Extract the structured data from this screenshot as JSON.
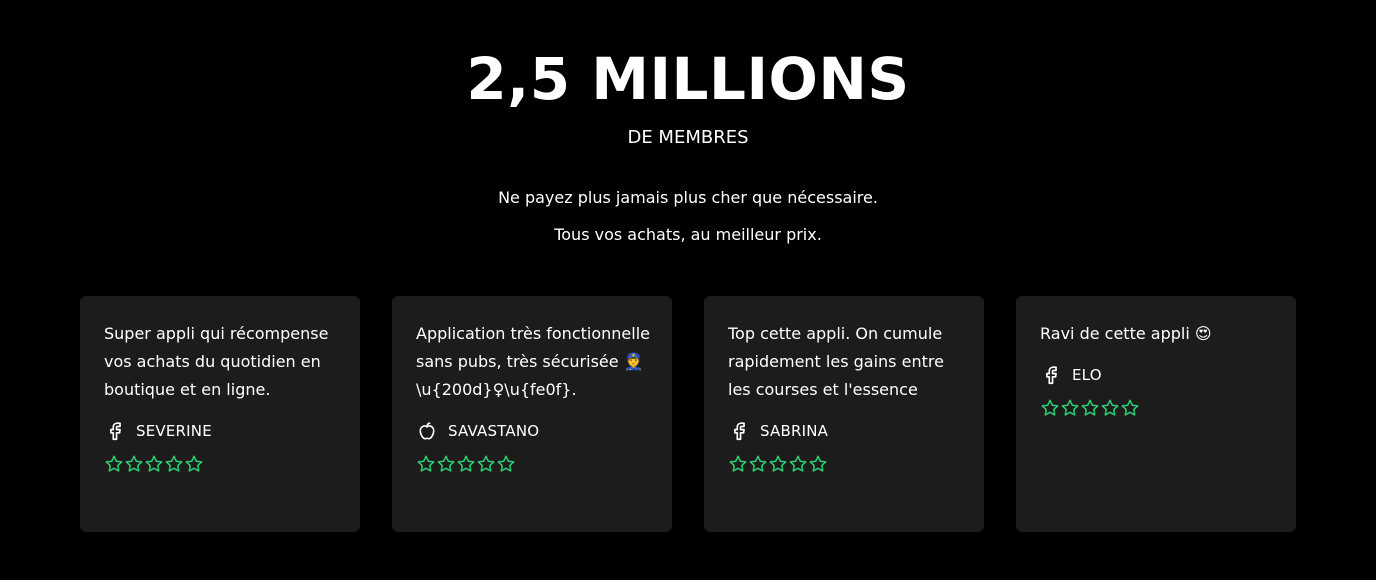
{
  "hero": {
    "headline": "2,5 MILLIONS",
    "subhead": "DE MEMBRES",
    "tagline_line1": "Ne payez plus jamais plus cher que nécessaire.",
    "tagline_line2": "Tous vos achats, au meilleur prix."
  },
  "colors": {
    "background": "#000000",
    "card": "#1c1c1c",
    "text": "#ffffff",
    "star": "#2ecc71"
  },
  "reviews": [
    {
      "text": "Super appli qui récompense vos achats du quotidien en boutique et en ligne.",
      "author": "SEVERINE",
      "source_icon": "facebook-icon",
      "rating": 5
    },
    {
      "text": "Application très fonctionnelle sans pubs, très sécurisée 👮\\u{200d}♀\\u{fe0f}.",
      "author": "SAVASTANO",
      "source_icon": "apple-icon",
      "rating": 5
    },
    {
      "text": "Top cette appli. On cumule rapidement les gains entre les courses et l'essence",
      "author": "SABRINA",
      "source_icon": "facebook-icon",
      "rating": 5
    },
    {
      "text": "Ravi de cette appli 😍",
      "author": "ELO",
      "source_icon": "facebook-icon",
      "rating": 5
    }
  ]
}
